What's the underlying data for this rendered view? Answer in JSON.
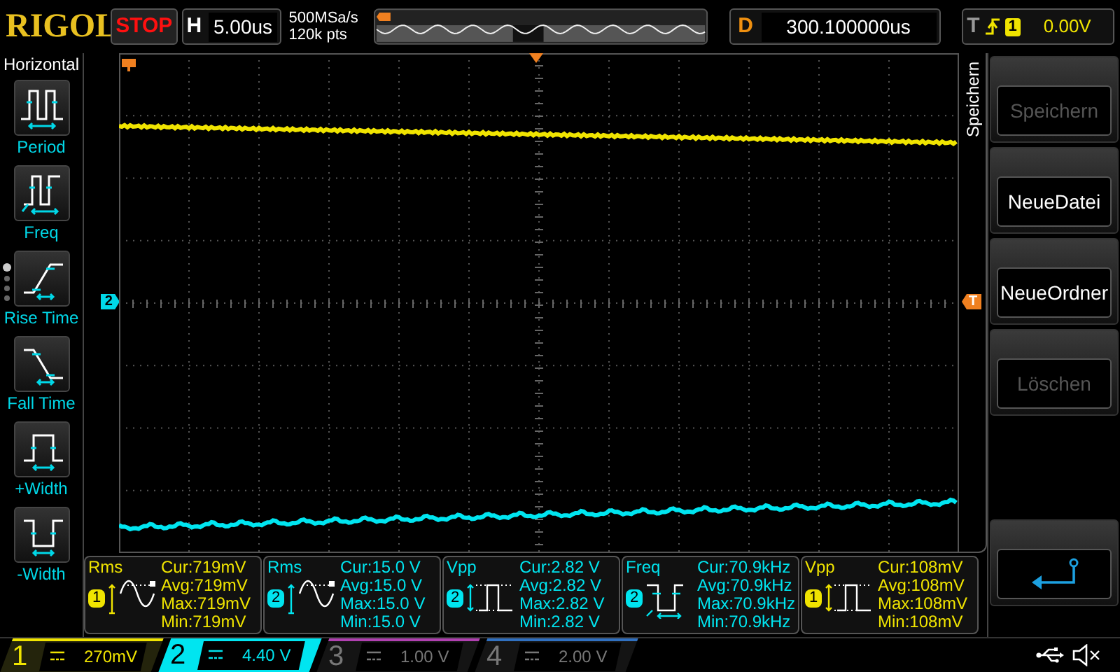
{
  "top_bar": {
    "logo": "RIGOL",
    "run_state": "STOP",
    "timebase": {
      "label": "H",
      "value": "5.00us"
    },
    "sample_rate": "500MSa/s",
    "memory_depth": "120k pts",
    "delay": {
      "label": "D",
      "value": "300.100000us"
    },
    "trigger": {
      "label": "T",
      "source": "1",
      "level": "0.00V"
    }
  },
  "measure_menu": {
    "title": "Horizontal",
    "pages": [
      {
        "selected": true
      },
      {
        "selected": false
      },
      {
        "selected": false
      },
      {
        "selected": false
      }
    ],
    "items": [
      {
        "kind": "period",
        "label": "Period"
      },
      {
        "kind": "freq",
        "label": "Freq"
      },
      {
        "kind": "rise",
        "label": "Rise Time"
      },
      {
        "kind": "fall",
        "label": "Fall Time"
      },
      {
        "kind": "pwidth",
        "label": "+Width"
      },
      {
        "kind": "nwidth",
        "label": "-Width"
      }
    ]
  },
  "screen": {
    "channel_marker": "2",
    "trigger_marker": "T"
  },
  "measurements": [
    {
      "name": "Rms",
      "channel": "1",
      "color": "#f0e400",
      "kind": "sine",
      "readings": [
        "Cur:719mV",
        "Avg:719mV",
        "Max:719mV",
        "Min:719mV"
      ]
    },
    {
      "name": "Rms",
      "channel": "2",
      "color": "#00e5f0",
      "kind": "sine",
      "readings": [
        "Cur:15.0 V",
        "Avg:15.0 V",
        "Max:15.0 V",
        "Min:15.0 V"
      ]
    },
    {
      "name": "Vpp",
      "channel": "2",
      "color": "#00e5f0",
      "kind": "pulse",
      "readings": [
        "Cur:2.82 V",
        "Avg:2.82 V",
        "Max:2.82 V",
        "Min:2.82 V"
      ]
    },
    {
      "name": "Freq",
      "channel": "2",
      "color": "#00e5f0",
      "kind": "freq",
      "readings": [
        "Cur:70.9kHz",
        "Avg:70.9kHz",
        "Max:70.9kHz",
        "Min:70.9kHz"
      ]
    },
    {
      "name": "Vpp",
      "channel": "1",
      "color": "#f0e400",
      "kind": "pulse",
      "readings": [
        "Cur:108mV",
        "Avg:108mV",
        "Max:108mV",
        "Min:108mV"
      ]
    }
  ],
  "side_menu": {
    "title": "Speichern",
    "buttons": [
      {
        "label": "Speichern",
        "disabled": true
      },
      {
        "label": "NeueDatei",
        "disabled": false
      },
      {
        "label": "NeueOrdner",
        "disabled": false
      },
      {
        "label": "Löschen",
        "disabled": true
      }
    ]
  },
  "channels": [
    {
      "number": "1",
      "scale": "270mV",
      "color": "#f0e400",
      "enabled": true,
      "selected": false
    },
    {
      "number": "2",
      "scale": "4.40 V",
      "color": "#00e5f0",
      "enabled": true,
      "selected": true
    },
    {
      "number": "3",
      "scale": "1.00 V",
      "color": "#b040b0",
      "enabled": false,
      "selected": false
    },
    {
      "number": "4",
      "scale": "2.00 V",
      "color": "#3070c0",
      "enabled": false,
      "selected": false
    }
  ]
}
